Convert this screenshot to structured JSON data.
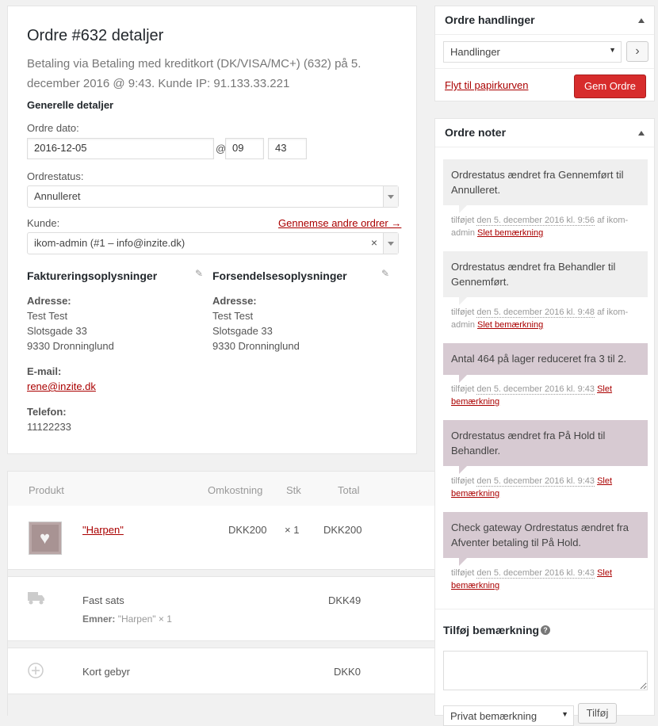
{
  "order": {
    "title": "Ordre #632 detaljer",
    "subtitle": "Betaling via Betaling med kreditkort (DK/VISA/MC+) (632) på 5. december 2016 @ 9:43. Kunde IP: 91.133.33.221",
    "general_heading": "Generelle detaljer",
    "date_label": "Ordre dato:",
    "date_value": "2016-12-05",
    "at_sign": "@",
    "hour_value": "09",
    "colon": ":",
    "minute_value": "43",
    "status_label": "Ordrestatus:",
    "status_value": "Annulleret",
    "customer_label": "Kunde:",
    "customer_link": "Gennemse andre ordrer →",
    "customer_value": "ikom-admin (#1 – info@inzite.dk)",
    "customer_clear": "×",
    "billing": {
      "heading": "Faktureringsoplysninger",
      "address_label": "Adresse:",
      "address_lines": [
        "Test Test",
        "Slotsgade 33",
        "9330 Dronninglund"
      ],
      "email_label": "E-mail:",
      "email": "rene@inzite.dk",
      "phone_label": "Telefon:",
      "phone": "11122233"
    },
    "shipping": {
      "heading": "Forsendelsesoplysninger",
      "address_label": "Adresse:",
      "address_lines": [
        "Test Test",
        "Slotsgade 33",
        "9330 Dronninglund"
      ]
    }
  },
  "items": {
    "headers": {
      "product": "Produkt",
      "cost": "Omkostning",
      "qty": "Stk",
      "total": "Total"
    },
    "product": {
      "name": "\"Harpen\"",
      "cost": "DKK200",
      "qty": "× 1",
      "total": "DKK200"
    },
    "shipping": {
      "name": "Fast sats",
      "items_label": "Emner:",
      "items_value": "\"Harpen\" × 1",
      "total": "DKK49"
    },
    "fee": {
      "name": "Kort gebyr",
      "total": "DKK0"
    }
  },
  "actions_box": {
    "title": "Ordre handlinger",
    "select_value": "Handlinger",
    "go": "›",
    "trash_link": "Flyt til papirkurven",
    "save": "Gem Ordre"
  },
  "notes_box": {
    "title": "Ordre noter",
    "notes": [
      {
        "text": "Ordrestatus ændret fra Gennemført til Annulleret.",
        "prefix": "tilføjet ",
        "date": "den 5. december 2016 kl. 9:56",
        "by": " af ikom-admin ",
        "delete": "Slet bemærkning",
        "kind": "system"
      },
      {
        "text": "Ordrestatus ændret fra Behandler til Gennemført.",
        "prefix": "tilføjet ",
        "date": "den 5. december 2016 kl. 9:48",
        "by": " af ikom-admin ",
        "delete": "Slet bemærkning",
        "kind": "system"
      },
      {
        "text": "Antal 464 på lager reduceret fra 3 til 2.",
        "prefix": "tilføjet ",
        "date": "den 5. december 2016 kl. 9:43",
        "by": " ",
        "delete": "Slet bemærkning",
        "kind": "customer"
      },
      {
        "text": "Ordrestatus ændret fra På Hold til Behandler.",
        "prefix": "tilføjet ",
        "date": "den 5. december 2016 kl. 9:43",
        "by": " ",
        "delete": "Slet bemærkning",
        "kind": "customer"
      },
      {
        "text": "Check gateway Ordrestatus ændret fra Afventer betaling til På Hold.",
        "prefix": "tilføjet ",
        "date": "den 5. december 2016 kl. 9:43",
        "by": " ",
        "delete": "Slet bemærkning",
        "kind": "customer"
      }
    ],
    "add_label": "Tilføj bemærkning",
    "help": "?",
    "note_type": "Privat bemærkning",
    "add_button": "Tilføj"
  },
  "colors": {
    "primary_button": "#d72c2c",
    "link": "#aa0000",
    "customer_note": "#d7cad2",
    "system_note": "#efefef"
  }
}
